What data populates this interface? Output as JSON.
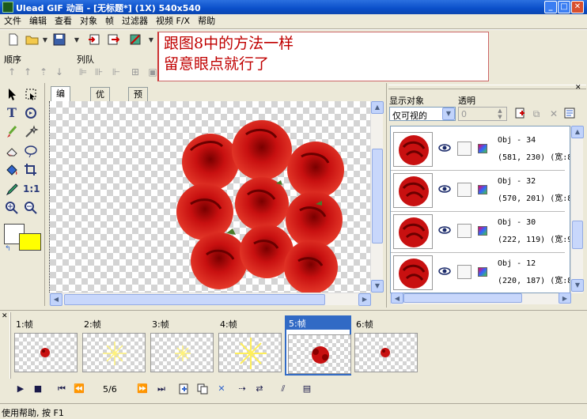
{
  "window": {
    "title": "Ulead GIF 动画 - [无标题*] (1X) 540x540"
  },
  "menu": [
    "文件",
    "编辑",
    "查看",
    "对象",
    "帧",
    "过滤器",
    "视频 F/X",
    "帮助"
  ],
  "toolbar_labels": {
    "order": "顺序",
    "queue": "列队"
  },
  "note": {
    "line1": "跟图8中的方法一样",
    "line2": "留意眼点就行了"
  },
  "tools": [
    "pointer-tool",
    "marquee-tool",
    "text-tool",
    "lasso-tool",
    "brush-tool",
    "magic-wand-tool",
    "eraser-tool",
    "ellipse-tool",
    "fill-tool",
    "crop-tool",
    "eyedropper-tool",
    "actual-size-tool",
    "zoom-in-tool",
    "zoom-out-tool"
  ],
  "actual_size_label": "1:1",
  "colors": {
    "foreground": "#ffffff",
    "background": "#ffff00",
    "accent": "#316ac5",
    "rose": "#c81010"
  },
  "editor_tabs": [
    "编辑",
    "优化",
    "预览"
  ],
  "object_panel": {
    "display_label": "显示对象",
    "transparency_label": "透明",
    "filter_value": "仅可视的",
    "opacity_value": "0",
    "objects": [
      {
        "name": "Obj - 34",
        "coords": "(581, 230) (宽:8"
      },
      {
        "name": "Obj - 32",
        "coords": "(570, 201) (宽:8"
      },
      {
        "name": "Obj - 30",
        "coords": "(222, 119) (宽:9"
      },
      {
        "name": "Obj - 12",
        "coords": "(220, 187) (宽:8"
      }
    ]
  },
  "frames": [
    {
      "label": "1:帧",
      "kind": "small-rose"
    },
    {
      "label": "2:帧",
      "kind": "sparkle"
    },
    {
      "label": "3:帧",
      "kind": "sparkle-small"
    },
    {
      "label": "4:帧",
      "kind": "sparkle-big"
    },
    {
      "label": "5:帧",
      "kind": "rose",
      "selected": true
    },
    {
      "label": "6:帧",
      "kind": "small-rose"
    }
  ],
  "playback": {
    "frame_counter": "5/6"
  },
  "status": {
    "text": "使用帮助, 按 F1"
  }
}
